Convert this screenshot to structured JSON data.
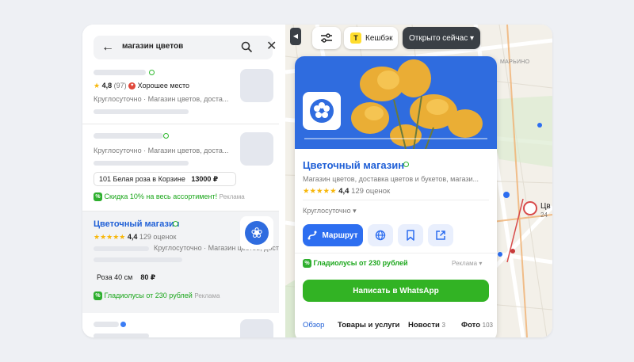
{
  "search": {
    "query": "магазин цветов",
    "back_icon": "arrow-left-icon",
    "search_icon": "magnifier-icon",
    "clear_icon": "close-icon"
  },
  "results": [
    {
      "rating": "4,8",
      "reviews": "(97)",
      "award": "Хорошее место",
      "meta": "Круглосуточно · Магазин цветов, доста..."
    },
    {
      "meta": "Круглосуточно · Магазин цветов, доста...",
      "offer_name": "101 Белая роза в Корзине",
      "offer_price": "13000 ₽",
      "promo": "Скидка 10% на весь ассортимент!",
      "ad_label": "Реклама"
    },
    {
      "name": "Цветочный магазин",
      "rating": "4,4",
      "reviews": "129 оценок",
      "meta": "Круглосуточно · Магазин цветов, доста...",
      "offer_name": "Роза 40 см",
      "offer_price": "80 ₽",
      "promo": "Гладиолусы от 230 рублей",
      "ad_label": "Реклама"
    }
  ],
  "map": {
    "filters_icon": "sliders-icon",
    "cashback_label": "Кешбэк",
    "cashback_badge": "Т",
    "open_now_label": "Открыто сейчас ▾",
    "district_label": "МАРЬИНО",
    "pin_label_1": "Цв",
    "pin_label_2": "24"
  },
  "card": {
    "title": "Цветочный магазин",
    "category": "Магазин цветов, доставка цветов и букетов, магази...",
    "rating": "4,4",
    "reviews": "129 оценок",
    "hours": "Круглосуточно ▾",
    "route_label": "Маршрут",
    "promo": "Гладиолусы от 230 рублей",
    "ad_label": "Реклама ▾",
    "whatsapp_label": "Написать в WhatsApp",
    "tabs": [
      {
        "label": "Обзор",
        "count": ""
      },
      {
        "label": "Товары и услуги",
        "count": ""
      },
      {
        "label": "Новости",
        "count": "3"
      },
      {
        "label": "Фото",
        "count": "103"
      }
    ]
  },
  "colors": {
    "accent": "#2d6ef0",
    "link": "#1f5fd6",
    "green": "#32b324",
    "star": "#f7b70a"
  }
}
